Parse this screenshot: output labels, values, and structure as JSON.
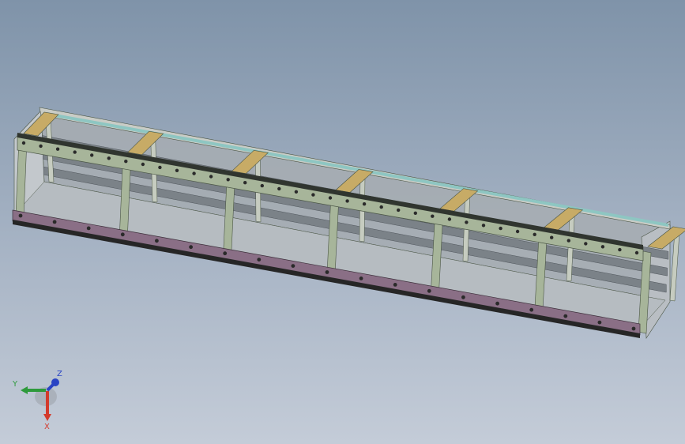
{
  "viewport": {
    "background_top": "#7f93a9",
    "background_bottom": "#c4ccd8"
  },
  "model": {
    "frame_color": "#a7b59a",
    "frame_edge": "#4a5545",
    "rail_color": "#c7ab66",
    "base_color": "#8a6f86",
    "side_color": "#a7adb2",
    "top_edge_color": "#8ec6c2",
    "bay_count": 6
  },
  "triad": {
    "x_label": "X",
    "y_label": "Y",
    "z_label": "Z",
    "x_color": "#d33a2c",
    "y_color": "#2e9a3c",
    "z_color": "#2a44c4"
  }
}
